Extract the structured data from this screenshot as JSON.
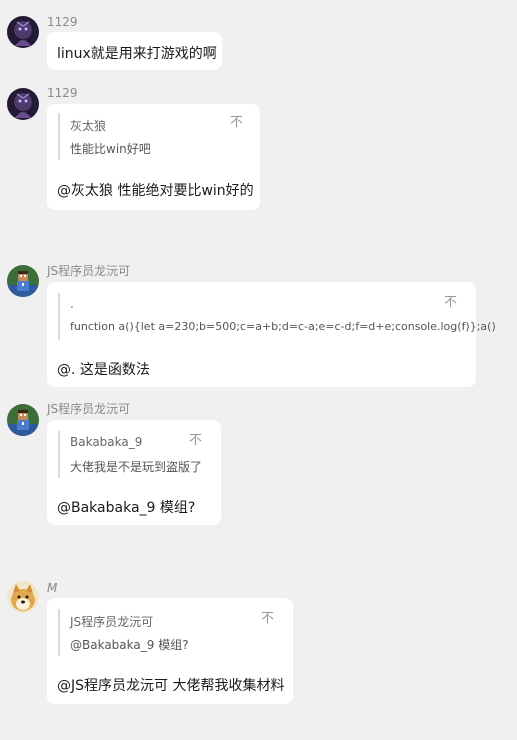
{
  "messages": [
    {
      "sender": "1129",
      "text": "linux就是用来打游戏的啊"
    },
    {
      "sender": "1129",
      "quote": {
        "author": "灰太狼",
        "body": "性能比win好吧",
        "icon": "不"
      },
      "text": "@灰太狼 性能绝对要比win好的"
    },
    {
      "sender": "JS程序员龙沅可",
      "quote": {
        "author": ".",
        "body": "function a(){let a=230;b=500;c=a+b;d=c-a;e=c-d;f=d+e;console.log(f)};a()",
        "icon": "不"
      },
      "text": "@. 这是函数法"
    },
    {
      "sender": "JS程序员龙沅可",
      "quote": {
        "author": "Bakabaka_9",
        "body": "大佬我是不是玩到盗版了",
        "icon": "不"
      },
      "text": "@Bakabaka_9 模组?"
    },
    {
      "sender": "M",
      "quote": {
        "author": "JS程序员龙沅可",
        "body": "@Bakabaka_9 模组?",
        "icon": "不"
      },
      "text": "@JS程序员龙沅可 大佬帮我收集材料"
    }
  ]
}
